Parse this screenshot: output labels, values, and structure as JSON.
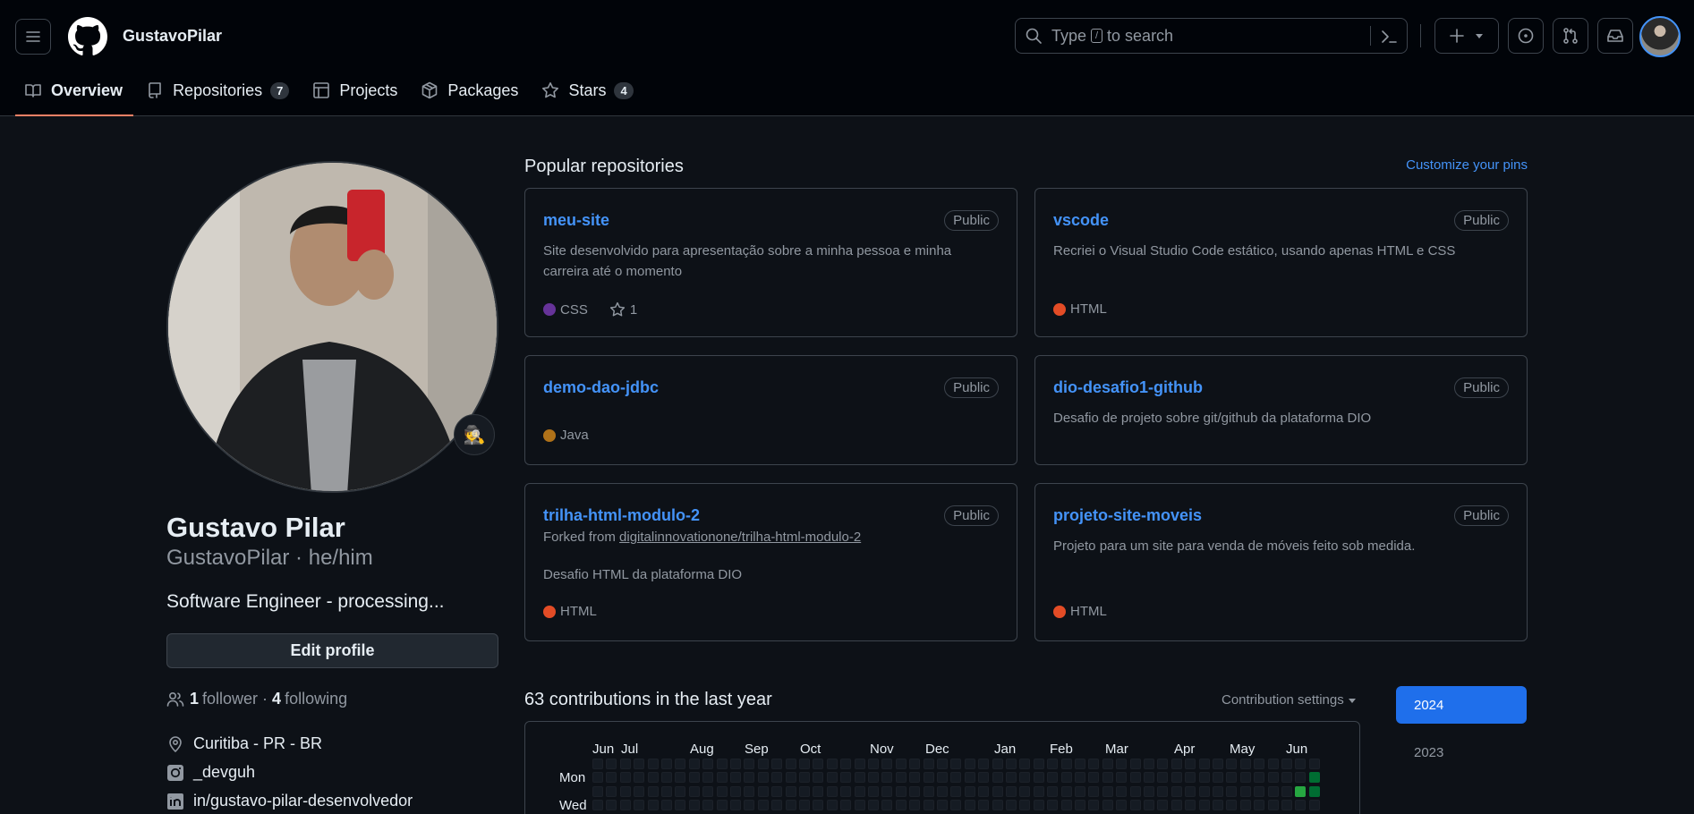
{
  "header": {
    "username": "GustavoPilar",
    "search": {
      "prefix": "Type",
      "key": "/",
      "suffix": "to search"
    }
  },
  "tabs": [
    {
      "label": "Overview",
      "icon": "book-icon",
      "active": true
    },
    {
      "label": "Repositories",
      "icon": "repo-icon",
      "count": "7"
    },
    {
      "label": "Projects",
      "icon": "table-icon"
    },
    {
      "label": "Packages",
      "icon": "package-icon"
    },
    {
      "label": "Stars",
      "icon": "star-icon",
      "count": "4"
    }
  ],
  "profile": {
    "name": "Gustavo Pilar",
    "handle": "GustavoPilar · he/him",
    "bio": "Software Engineer - processing...",
    "edit_label": "Edit profile",
    "status_emoji": "🕵️",
    "followers_count": "1",
    "followers_label": "follower",
    "sep": "·",
    "following_count": "4",
    "following_label": "following",
    "location": "Curitiba - PR - BR",
    "instagram": "_devguh",
    "linkedin": "in/gustavo-pilar-desenvolvedor"
  },
  "pinned": {
    "title": "Popular repositories",
    "customize": "Customize your pins",
    "repos": [
      {
        "name": "meu-site",
        "visibility": "Public",
        "description": "Site desenvolvido para apresentação sobre a minha pessoa e minha carreira até o momento",
        "language": "CSS",
        "language_color": "#663399",
        "stars": "1"
      },
      {
        "name": "vscode",
        "visibility": "Public",
        "description": "Recriei o Visual Studio Code estático, usando apenas HTML e CSS",
        "language": "HTML",
        "language_color": "#e34c26"
      },
      {
        "name": "demo-dao-jdbc",
        "visibility": "Public",
        "description": "",
        "language": "Java",
        "language_color": "#b07219"
      },
      {
        "name": "dio-desafio1-github",
        "visibility": "Public",
        "description": "Desafio de projeto sobre git/github da plataforma DIO",
        "language": "",
        "language_color": ""
      },
      {
        "name": "trilha-html-modulo-2",
        "visibility": "Public",
        "forked_prefix": "Forked from",
        "forked_from": "digitalinnovationone/trilha-html-modulo-2",
        "description": "Desafio HTML da plataforma DIO",
        "language": "HTML",
        "language_color": "#e34c26"
      },
      {
        "name": "projeto-site-moveis",
        "visibility": "Public",
        "description": "Projeto para um site para venda de móveis feito sob medida.",
        "language": "HTML",
        "language_color": "#e34c26"
      }
    ]
  },
  "contributions": {
    "title": "63 contributions in the last year",
    "settings_label": "Contribution settings",
    "months": [
      "Jun",
      "Jul",
      "Aug",
      "Sep",
      "Oct",
      "Nov",
      "Dec",
      "Jan",
      "Feb",
      "Mar",
      "Apr",
      "May",
      "Jun"
    ],
    "day_labels": [
      "Mon",
      "Wed"
    ],
    "years": [
      "2024",
      "2023"
    ],
    "active_year": "2024"
  },
  "colors": {
    "accent": "#4493f8",
    "tab_underline": "#f78166",
    "year_selected": "#1f6feb",
    "contrib_level_1": "#0e4429",
    "contrib_level_2": "#006d32",
    "contrib_level_3": "#26a641"
  }
}
